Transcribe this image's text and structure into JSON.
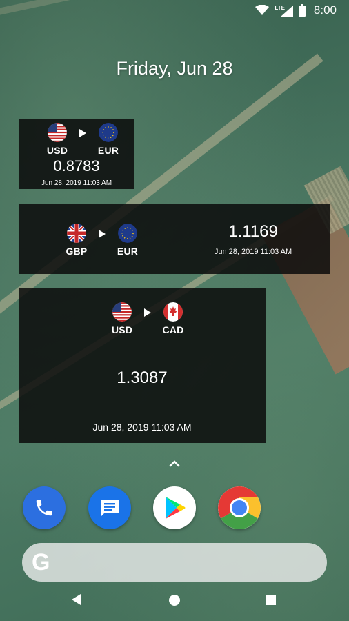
{
  "status_bar": {
    "network": "LTE",
    "time": "8:00"
  },
  "date_label": "Friday, Jun 28",
  "widgets": [
    {
      "from": "USD",
      "to": "EUR",
      "rate": "0.8783",
      "updated": "Jun 28, 2019 11:03 AM"
    },
    {
      "from": "GBP",
      "to": "EUR",
      "rate": "1.1169",
      "updated": "Jun 28, 2019 11:03 AM"
    },
    {
      "from": "USD",
      "to": "CAD",
      "rate": "1.3087",
      "updated": "Jun 28, 2019 11:03 AM"
    }
  ],
  "dock": {
    "apps": [
      "phone-app",
      "messages-app",
      "play-store-app",
      "chrome-app"
    ]
  },
  "search_bar": {
    "logo": "G"
  },
  "colors": {
    "widget_bg": "#0a0a0a",
    "phone": "#2c6fe0",
    "messages": "#1a73e8"
  }
}
